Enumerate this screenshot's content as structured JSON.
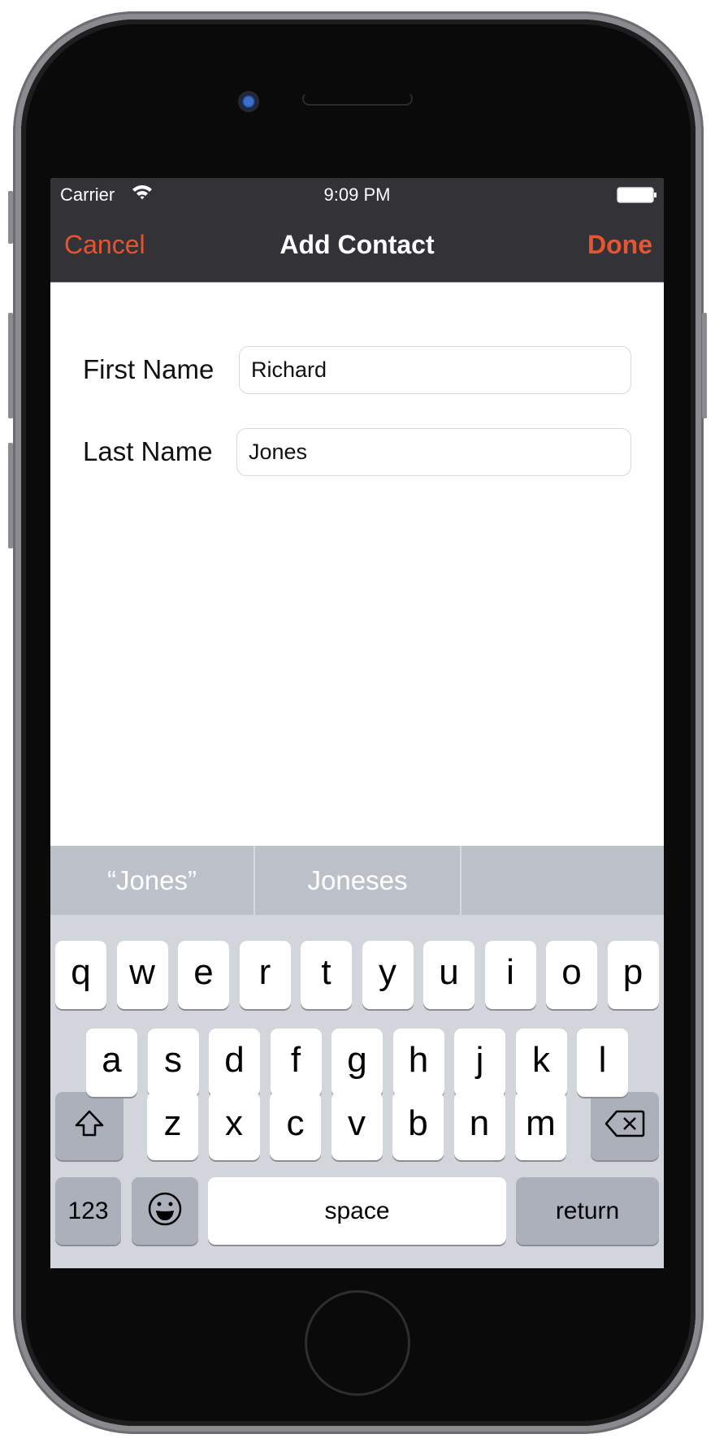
{
  "status_bar": {
    "carrier": "Carrier",
    "time": "9:09 PM",
    "wifi_icon": "wifi-icon",
    "battery_icon": "battery-icon"
  },
  "nav_bar": {
    "title": "Add Contact",
    "cancel_label": "Cancel",
    "done_label": "Done",
    "accent_color": "#e8542f"
  },
  "form": {
    "fields": [
      {
        "label": "First Name",
        "value": "Richard"
      },
      {
        "label": "Last Name",
        "value": "Jones"
      }
    ]
  },
  "suggestions": [
    "“Jones”",
    "Joneses",
    ""
  ],
  "keyboard": {
    "row1": [
      "q",
      "w",
      "e",
      "r",
      "t",
      "y",
      "u",
      "i",
      "o",
      "p"
    ],
    "row2": [
      "a",
      "s",
      "d",
      "f",
      "g",
      "h",
      "j",
      "k",
      "l"
    ],
    "row3": [
      "z",
      "x",
      "c",
      "v",
      "b",
      "n",
      "m"
    ],
    "numbers_label": "123",
    "space_label": "space",
    "return_label": "return",
    "shift_icon": "shift-icon",
    "delete_icon": "delete-icon",
    "emoji_icon": "emoji-icon"
  }
}
